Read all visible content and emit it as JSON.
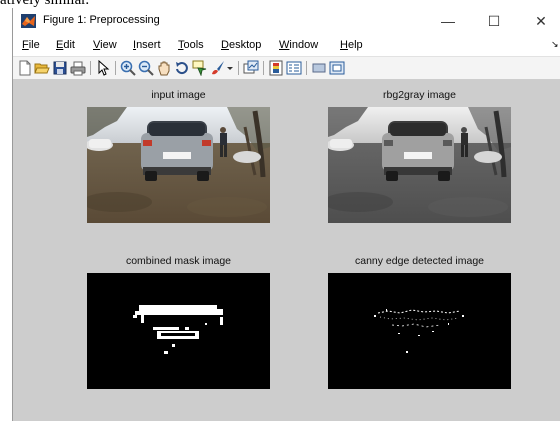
{
  "page_fragment": "atively similar.",
  "window": {
    "title": "Figure 1: Preprocessing",
    "controls": {
      "minimize": "—",
      "maximize": "☐",
      "close": "✕"
    }
  },
  "menu": {
    "items": [
      {
        "key": "F",
        "rest": "ile"
      },
      {
        "key": "E",
        "rest": "dit"
      },
      {
        "key": "V",
        "rest": "iew"
      },
      {
        "key": "I",
        "rest": "nsert"
      },
      {
        "key": "T",
        "rest": "ools"
      },
      {
        "key": "D",
        "rest": "esktop"
      },
      {
        "key": "W",
        "rest": "indow"
      },
      {
        "key": "H",
        "rest": "elp"
      }
    ],
    "overflow": "↘"
  },
  "toolbar": {
    "icons": [
      "new-figure-icon",
      "open-file-icon",
      "save-icon",
      "print-icon",
      "pointer-icon",
      "zoom-in-icon",
      "zoom-out-icon",
      "pan-icon",
      "rotate-3d-icon",
      "data-cursor-icon",
      "brush-icon",
      "dropdown-icon",
      "link-plot-icon",
      "colorbar-icon",
      "legend-icon",
      "hide-plot-tools-icon",
      "show-plot-tools-icon"
    ]
  },
  "subplots": [
    {
      "title": "input image",
      "kind": "color-photo"
    },
    {
      "title": "rbg2gray image",
      "kind": "gray-photo"
    },
    {
      "title": "combined mask image",
      "kind": "binary-mask"
    },
    {
      "title": "canny edge detected image",
      "kind": "edge-map"
    }
  ],
  "colors": {
    "figure_background": "#cdcdcd",
    "matlab_orange": "#e8641b",
    "mask_background": "#000000",
    "mask_foreground": "#ffffff"
  }
}
